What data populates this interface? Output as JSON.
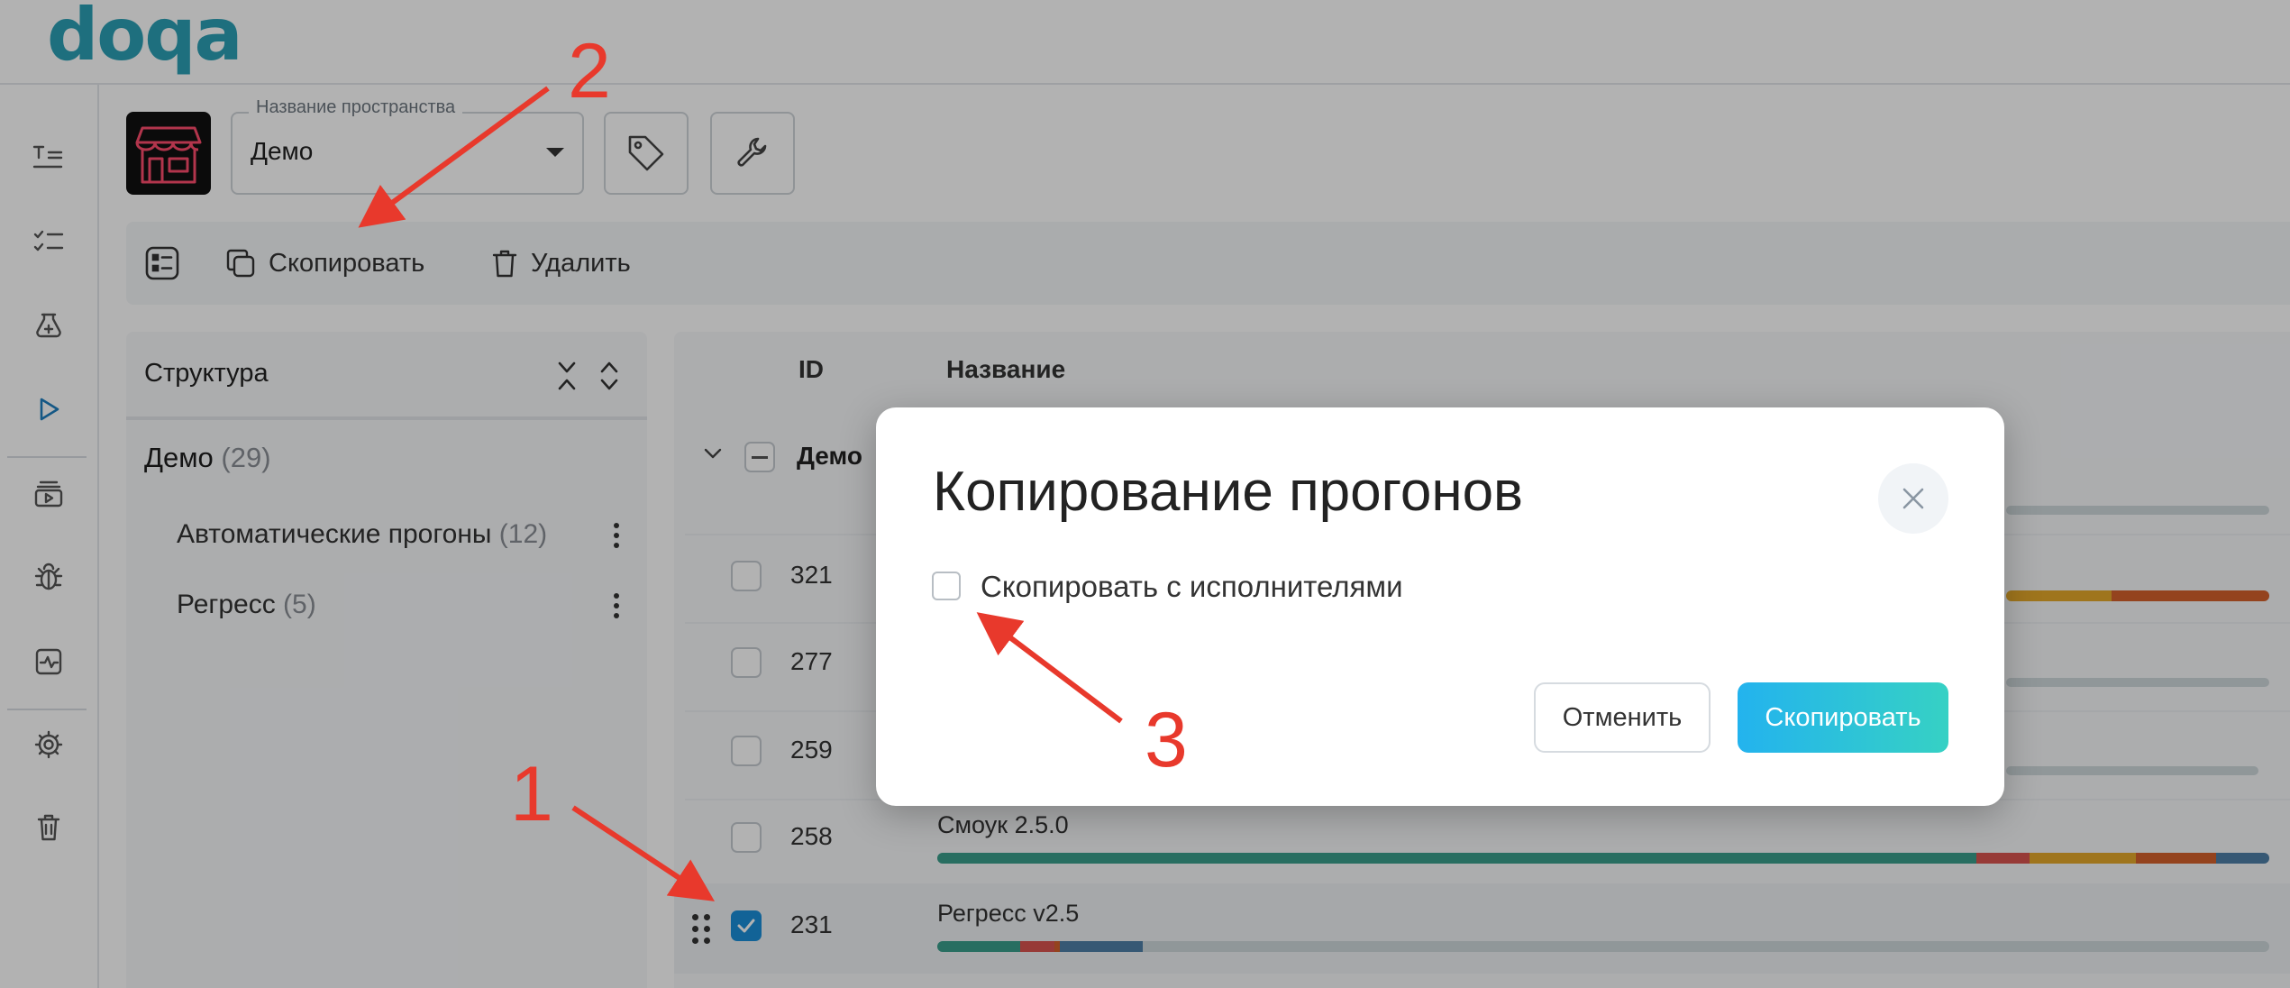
{
  "app": {
    "logo": "doqa"
  },
  "colors": {
    "accent": "#2ca0b5",
    "primary": "#23b3ee",
    "annotation": "#e8392c",
    "checked": "#1a8fd8"
  },
  "rail": {
    "icons": [
      "text-list-icon",
      "checklist-icon",
      "add-test-icon",
      "play-icon",
      "run-media-icon",
      "bug-icon",
      "pulse-chart-icon",
      "gear-icon",
      "trash-icon"
    ]
  },
  "space": {
    "label": "Название пространства",
    "value": "Демо"
  },
  "toolbar": {
    "copy_label": "Скопировать",
    "delete_label": "Удалить"
  },
  "structure": {
    "title": "Структура",
    "root": {
      "label": "Демо",
      "count": "(29)"
    },
    "items": [
      {
        "label": "Автоматические прогоны",
        "count": "(12)"
      },
      {
        "label": "Регресс",
        "count": "(5)"
      }
    ]
  },
  "table": {
    "headers": {
      "id": "ID",
      "name": "Название"
    },
    "group": {
      "label": "Демо"
    },
    "rows": [
      {
        "id": "321",
        "name": "",
        "checked": false
      },
      {
        "id": "277",
        "name": "",
        "checked": false
      },
      {
        "id": "259",
        "name": "",
        "checked": false
      },
      {
        "id": "258",
        "name": "Смоук 2.5.0",
        "checked": false
      },
      {
        "id": "231",
        "name": "Регресс v2.5",
        "checked": true
      }
    ]
  },
  "modal": {
    "title": "Копирование прогонов",
    "checkbox_label": "Скопировать с исполнителями",
    "cancel_label": "Отменить",
    "confirm_label": "Скопировать"
  },
  "annotations": {
    "one": "1",
    "two": "2",
    "three": "3"
  }
}
